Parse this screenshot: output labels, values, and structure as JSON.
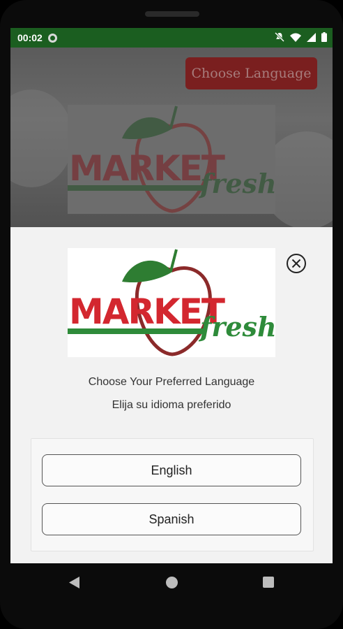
{
  "status_bar": {
    "time": "00:02",
    "icons": [
      "notification-app-icon",
      "mute-icon",
      "wifi-icon",
      "signal-icon",
      "battery-icon"
    ]
  },
  "background": {
    "choose_language_button": "Choose Language"
  },
  "logo": {
    "word": "MARKET",
    "script": "fresh",
    "colors": {
      "red": "#d3272f",
      "green": "#2e8b3a"
    }
  },
  "dialog": {
    "prompt_en": "Choose Your Preferred Language",
    "prompt_es": "Elija su idioma preferido",
    "options": [
      {
        "label": "English"
      },
      {
        "label": "Spanish"
      }
    ]
  },
  "colors": {
    "status_bar": "#1b5e20",
    "button_red": "#7a1f1f"
  }
}
